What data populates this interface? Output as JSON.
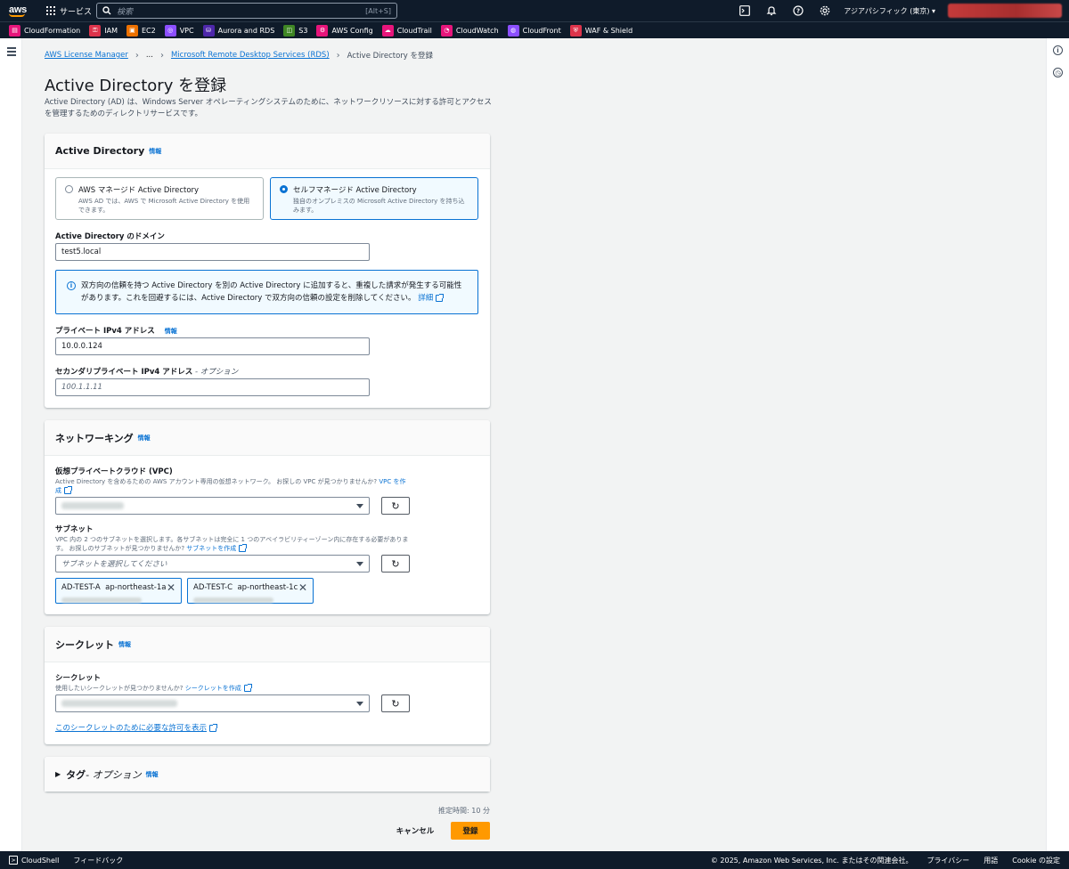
{
  "topnav": {
    "logo": "aws",
    "services_label": "サービス",
    "search_placeholder": "検索",
    "search_shortcut": "[Alt+S]",
    "region": "アジアパシフィック (東京) ▾"
  },
  "favorites": [
    {
      "label": "CloudFormation",
      "color": "#e7157b",
      "icon": "cloudformation-icon",
      "glyph": "▤"
    },
    {
      "label": "IAM",
      "color": "#dd344c",
      "icon": "iam-icon",
      "glyph": "⚿"
    },
    {
      "label": "EC2",
      "color": "#ed7100",
      "icon": "ec2-icon",
      "glyph": "▣"
    },
    {
      "label": "VPC",
      "color": "#8c4fff",
      "icon": "vpc-icon",
      "glyph": "◎"
    },
    {
      "label": "Aurora and RDS",
      "color": "#4d27aa",
      "icon": "rds-icon",
      "glyph": "⛁"
    },
    {
      "label": "S3",
      "color": "#3f8624",
      "icon": "s3-icon",
      "glyph": "◫"
    },
    {
      "label": "AWS Config",
      "color": "#e7157b",
      "icon": "config-icon",
      "glyph": "⚙"
    },
    {
      "label": "CloudTrail",
      "color": "#e7157b",
      "icon": "cloudtrail-icon",
      "glyph": "☁"
    },
    {
      "label": "CloudWatch",
      "color": "#e7157b",
      "icon": "cloudwatch-icon",
      "glyph": "◔"
    },
    {
      "label": "CloudFront",
      "color": "#8c4fff",
      "icon": "cloudfront-icon",
      "glyph": "◍"
    },
    {
      "label": "WAF & Shield",
      "color": "#dd344c",
      "icon": "waf-icon",
      "glyph": "⛨"
    }
  ],
  "breadcrumb": {
    "root": "AWS License Manager",
    "ellipsis": "...",
    "parent": "Microsoft Remote Desktop Services (RDS)",
    "current": "Active Directory を登録"
  },
  "page": {
    "title": "Active Directory を登録",
    "description": "Active Directory (AD) は、Windows Server オペレーティングシステムのために、ネットワークリソースに対する許可とアクセスを管理するためのディレクトリサービスです。"
  },
  "ad_section": {
    "heading": "Active Directory",
    "info": "情報",
    "options": [
      {
        "title": "AWS マネージド Active Directory",
        "desc": "AWS AD では、AWS で Microsoft Active Directory を使用できます。",
        "selected": false
      },
      {
        "title": "セルフマネージド Active Directory",
        "desc": "独自のオンプレミスの Microsoft Active Directory を持ち込みます。",
        "selected": true
      }
    ],
    "domain_label": "Active Directory のドメイン",
    "domain_value": "test5.local",
    "alert_text": "双方向の信頼を持つ Active Directory を別の Active Directory に追加すると、重複した請求が発生する可能性があります。これを回避するには、Active Directory で双方向の信頼の設定を削除してください。",
    "alert_link": "詳細",
    "ip_label": "プライベート IPv4 アドレス",
    "ip_info": "情報",
    "ip_value": "10.0.0.124",
    "ip2_label": "セカンダリプライベート IPv4 アドレス",
    "ip2_optional": " - オプション",
    "ip2_placeholder": "100.1.1.11"
  },
  "networking": {
    "heading": "ネットワーキング",
    "info": "情報",
    "vpc_label": "仮想プライベートクラウド (VPC)",
    "vpc_desc": "Active Directory を含めるための AWS アカウント専用の仮想ネットワーク。 お探しの VPC が見つかりませんか?",
    "vpc_link": "VPC を作成",
    "subnet_label": "サブネット",
    "subnet_desc": "VPC 内の 2 つのサブネットを選択します。各サブネットは完全に 1 つのアベイラビリティーゾーン内に存在する必要があります。 お探しのサブネットが見つかりませんか?",
    "subnet_link": "サブネットを作成",
    "subnet_placeholder": "サブネットを選択してください",
    "tokens": [
      {
        "name": "AD-TEST-A",
        "az": "ap-northeast-1a"
      },
      {
        "name": "AD-TEST-C",
        "az": "ap-northeast-1c"
      }
    ]
  },
  "secret": {
    "heading": "シークレット",
    "info": "情報",
    "label": "シークレット",
    "desc": "使用したいシークレットが見つかりませんか?",
    "desc_link": "シークレットを作成",
    "perm_link": "このシークレットのために必要な許可を表示"
  },
  "tags": {
    "heading": "タグ",
    "optional": " - オプション",
    "info": "情報"
  },
  "actions": {
    "estimate": "推定時間: 10 分",
    "cancel": "キャンセル",
    "submit": "登録"
  },
  "bottombar": {
    "cloudshell": "CloudShell",
    "feedback": "フィードバック",
    "copyright": "© 2025, Amazon Web Services, Inc. またはその関連会社。",
    "privacy": "プライバシー",
    "terms": "用語",
    "cookie": "Cookie の設定"
  }
}
